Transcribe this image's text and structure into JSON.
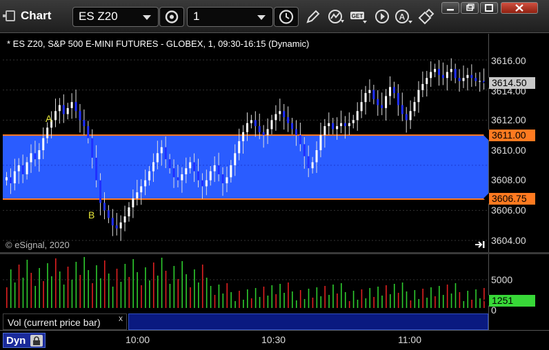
{
  "window": {
    "title": "Chart",
    "symbol_value": "ES Z20",
    "interval_value": "1"
  },
  "chart": {
    "title": "* ES Z20, S&P 500 E-MINI FUTURES - GLOBEX, 1, 09:30-16:15 (Dynamic)",
    "copyright": "© eSignal, 2020",
    "annotations": [
      "A",
      "B"
    ],
    "price_ticks": [
      "3616.00",
      "3614.00",
      "3612.00",
      "3610.00",
      "3608.00",
      "3606.00",
      "3604.00"
    ],
    "price_tags": {
      "last": "3614.50",
      "upper": "3611.00",
      "lower": "3606.75"
    },
    "volume_ticks": [
      "5000",
      "0"
    ],
    "volume_tag": "1251",
    "time_labels": [
      "10:00",
      "10:30",
      "11:00"
    ],
    "volume_legend": "Vol (current price bar)",
    "volume_legend_close": "x",
    "status": "Dyn"
  },
  "colors": {
    "band": "#2a5cff",
    "band_line": "#ff7a20",
    "up_candle": "#ffffff",
    "down_candle": "#2030ff",
    "vol_up": "#2ecc2e",
    "vol_down": "#e02020",
    "last_tag": "#c8c8c8",
    "band_tag": "#ff7a20",
    "volume_tag_bg": "#38d838",
    "annotation": "#e8e83a"
  },
  "icons": [
    "chart-icon",
    "clock-icon",
    "pencil-icon",
    "indicator-icon",
    "get-icon",
    "play-icon",
    "alert-icon",
    "link-icon",
    "settings-icon"
  ]
}
